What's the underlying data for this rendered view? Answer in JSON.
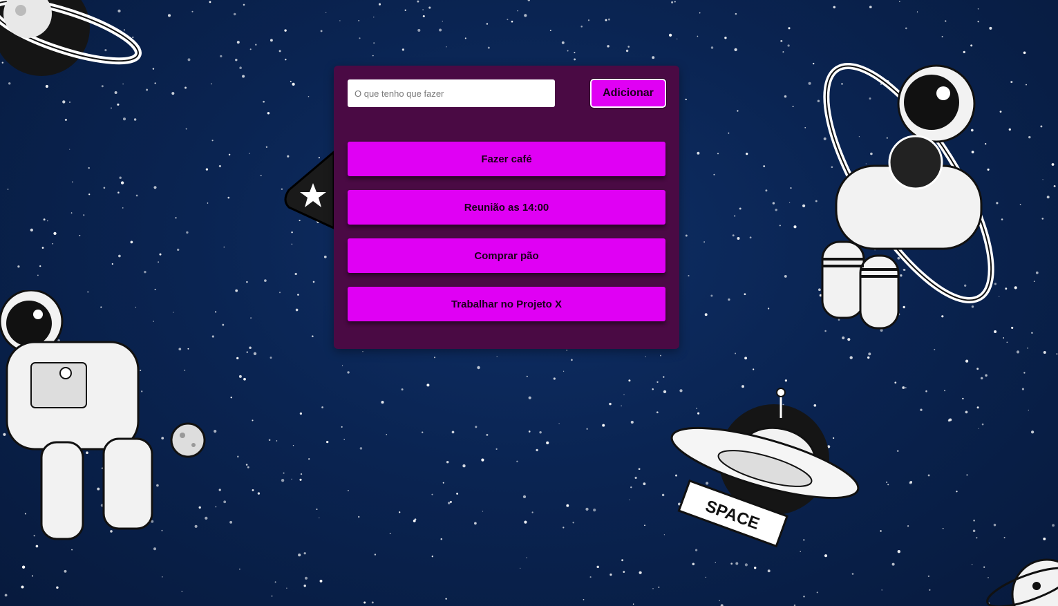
{
  "todo": {
    "input_placeholder": "O que tenho que fazer",
    "input_value": "",
    "add_label": "Adicionar",
    "items": [
      {
        "label": "Fazer café"
      },
      {
        "label": "Reunião as 14:00"
      },
      {
        "label": "Comprar pão"
      },
      {
        "label": "Trabalhar no Projeto X"
      }
    ]
  },
  "background": {
    "sticker_label": "SPACE"
  },
  "colors": {
    "background": "#0a2452",
    "panel": "#4a0a44",
    "accent": "#e000f4",
    "text_dark": "#1a001a"
  }
}
